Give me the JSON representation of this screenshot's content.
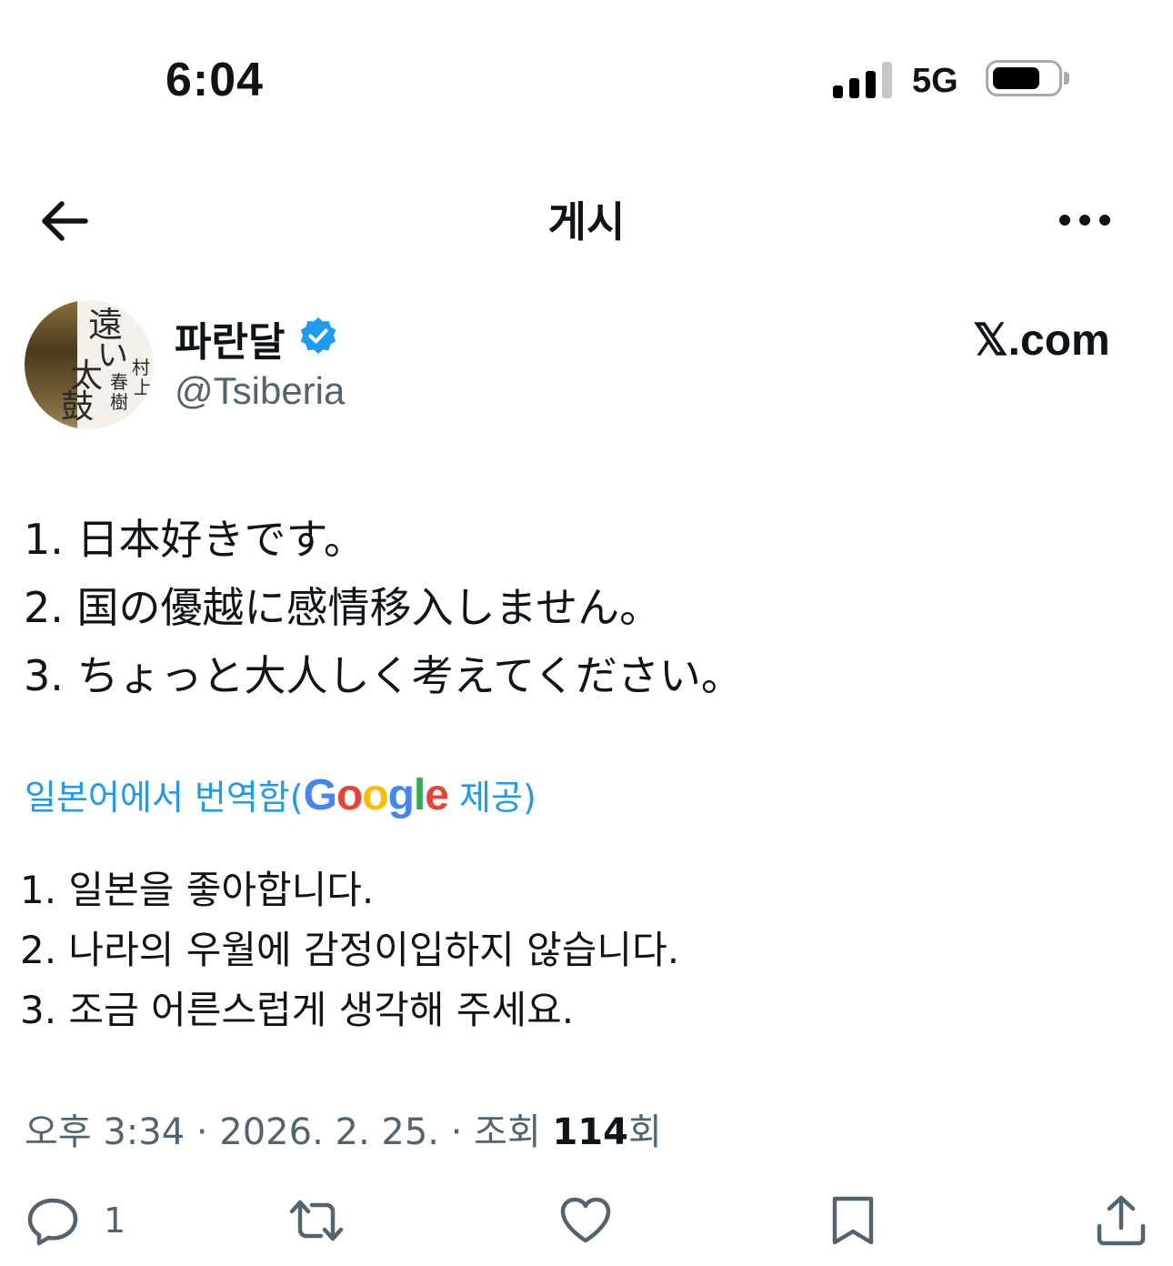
{
  "status_bar": {
    "time": "6:04",
    "network": "5G"
  },
  "header": {
    "title": "게시"
  },
  "author": {
    "display_name": "파란달",
    "handle": "@Tsiberia",
    "avatar_text": [
      "遠",
      "い",
      "太",
      "鼓",
      "村",
      "上",
      "春",
      "樹"
    ],
    "source": "𝕏.com"
  },
  "tweet": {
    "original_lines": [
      "1. 日本好きです。",
      "2. 国の優越に感情移入しません。",
      "3. ちょっと大人しく考えてください。"
    ],
    "translate_prefix": "일본어에서 번역함(",
    "translate_brand": [
      "G",
      "o",
      "o",
      "g",
      "l",
      "e"
    ],
    "translate_suffix": " 제공)",
    "translated_lines": [
      "1. 일본을 좋아합니다.",
      "2. 나라의 우월에 감정이입하지 않습니다.",
      "3. 조금 어른스럽게 생각해 주세요."
    ],
    "meta_prefix": "오후 3:34 · 2026. 2. 25. · 조회 ",
    "views": "114",
    "meta_suffix": "회"
  },
  "actions": {
    "reply_count": "1"
  },
  "colors": {
    "text": "#0f1419",
    "secondary": "#536471",
    "link": "#1d9bf0",
    "verified": "#1d9bf0",
    "google": [
      "#4285F4",
      "#EA4335",
      "#FBBC05",
      "#4285F4",
      "#34A853",
      "#EA4335"
    ]
  }
}
